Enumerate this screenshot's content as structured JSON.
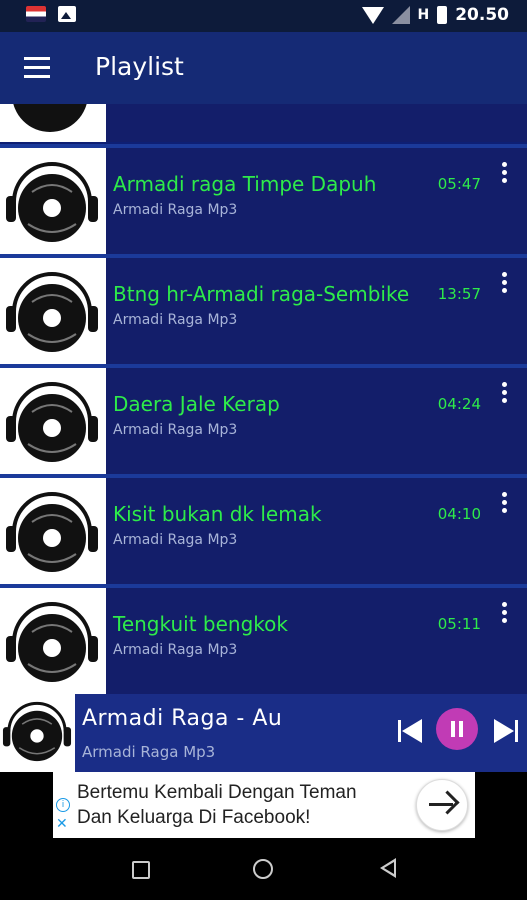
{
  "status_bar": {
    "time": "20.50",
    "network": "H"
  },
  "app_bar": {
    "title": "Playlist"
  },
  "playlist": {
    "items": [
      {
        "title": "Armadi raga Timpe Dapuh",
        "artist": "Armadi Raga Mp3",
        "duration": "05:47"
      },
      {
        "title": "Btng hr-Armadi raga-Sembike",
        "artist": "Armadi Raga Mp3",
        "duration": "13:57"
      },
      {
        "title": "Daera Jale Kerap",
        "artist": "Armadi Raga Mp3",
        "duration": "04:24"
      },
      {
        "title": "Kisit bukan dk lemak",
        "artist": "Armadi Raga Mp3",
        "duration": "04:10"
      },
      {
        "title": "Tengkuit bengkok",
        "artist": "Armadi Raga Mp3",
        "duration": "05:11"
      }
    ]
  },
  "now_playing": {
    "title": "Armadi Raga - Au",
    "artist": "Armadi Raga Mp3"
  },
  "ad": {
    "line1": "Bertemu Kembali Dengan Teman",
    "line2": "Dan Keluarga Di Facebook!"
  },
  "colors": {
    "title_green": "#2eeb4a",
    "list_bg": "#131e6a",
    "app_bar": "#152a75",
    "pause_button": "#c13bb5"
  }
}
